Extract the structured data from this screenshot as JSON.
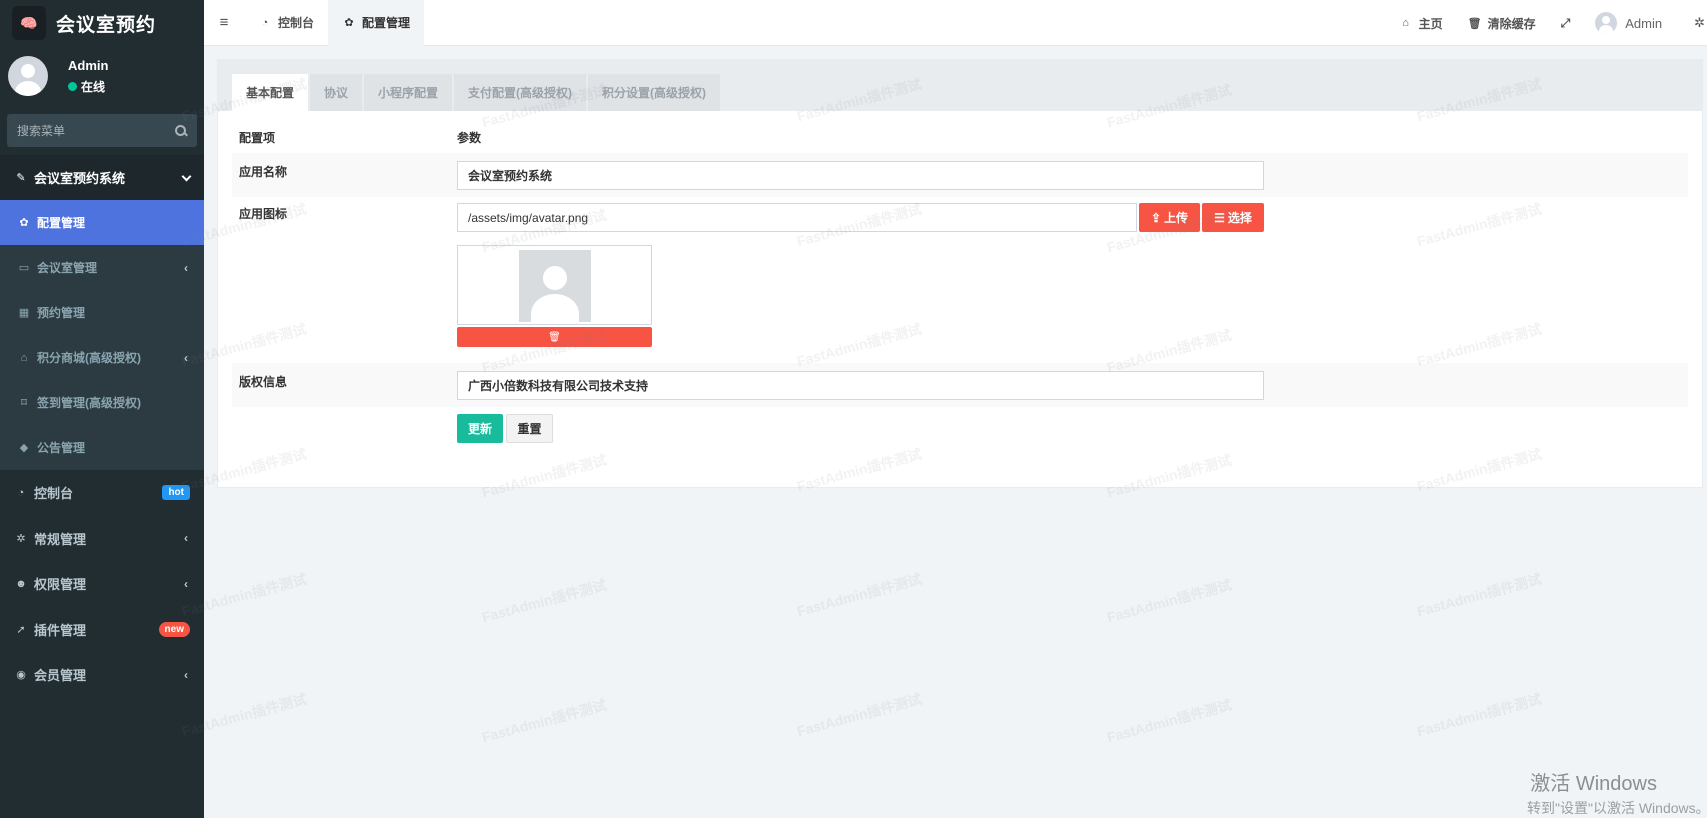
{
  "sidebar": {
    "brand_logo": "🧠",
    "brand_title": "会议室预约",
    "user_name": "Admin",
    "user_status": "在线",
    "search_placeholder": "搜索菜单",
    "group_title": "会议室预约系统",
    "submenu": [
      {
        "label": "配置管理",
        "icon": "gear-icon",
        "active": true
      },
      {
        "label": "会议室管理",
        "icon": "monitor-icon"
      },
      {
        "label": "预约管理",
        "icon": "table-icon"
      },
      {
        "label": "积分商城(高级授权)",
        "icon": "basket-icon"
      },
      {
        "label": "签到管理(高级授权)",
        "icon": "bookmark-icon"
      },
      {
        "label": "公告管理",
        "icon": "tag-icon"
      }
    ],
    "items": [
      {
        "label": "控制台",
        "icon": "dashboard-icon",
        "badge": "hot"
      },
      {
        "label": "常规管理",
        "icon": "cogs-icon"
      },
      {
        "label": "权限管理",
        "icon": "group-icon"
      },
      {
        "label": "插件管理",
        "icon": "rocket-icon",
        "badge": "new"
      },
      {
        "label": "会员管理",
        "icon": "user-circle-icon"
      }
    ]
  },
  "topbar": {
    "tabs": [
      {
        "label": "控制台",
        "icon": "dashboard-icon"
      },
      {
        "label": "配置管理",
        "icon": "gear-icon",
        "active": true
      }
    ],
    "home": "主页",
    "clear_cache": "清除缓存",
    "user": "Admin"
  },
  "panel": {
    "tabs": [
      "基本配置",
      "协议",
      "小程序配置",
      "支付配置(高级授权)",
      "积分设置(高级授权)"
    ],
    "col_item": "配置项",
    "col_param": "参数",
    "app_name_label": "应用名称",
    "app_name_value": "会议室预约系统",
    "app_icon_label": "应用图标",
    "app_icon_value": "/assets/img/avatar.png",
    "upload_label": "上传",
    "choose_label": "选择",
    "copyright_label": "版权信息",
    "copyright_value": "广西小倍数科技有限公司技术支持",
    "submit_label": "更新",
    "reset_label": "重置"
  },
  "watermark_text": "FastAdmin插件测试",
  "activate_windows": "激活 Windows",
  "activate_windows_sub": "转到\"设置\"以激活 Windows。"
}
